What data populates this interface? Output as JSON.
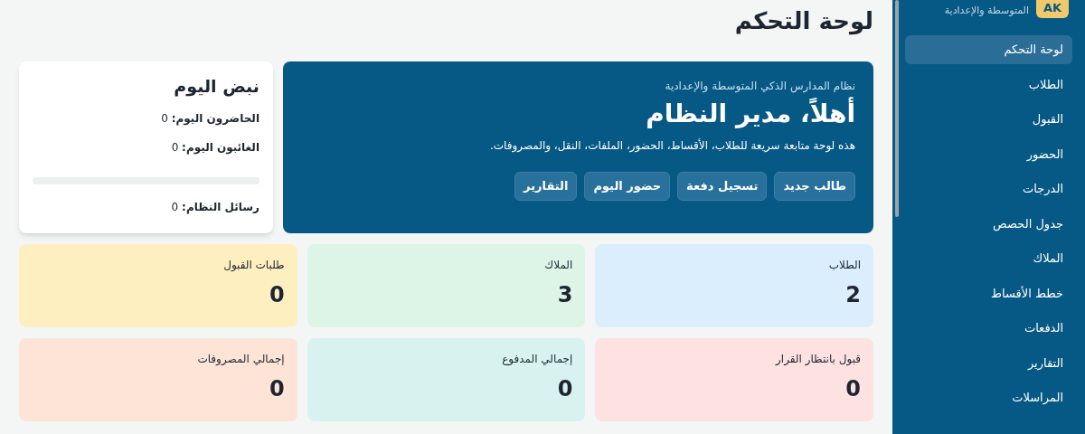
{
  "sidebar": {
    "avatar": "AK",
    "subtitle": "المتوسطة والإعدادية",
    "items": [
      {
        "label": "لوحة التحكم",
        "selected": true
      },
      {
        "label": "الطلاب",
        "selected": false
      },
      {
        "label": "القبول",
        "selected": false
      },
      {
        "label": "الحضور",
        "selected": false
      },
      {
        "label": "الدرجات",
        "selected": false
      },
      {
        "label": "جدول الحصص",
        "selected": false
      },
      {
        "label": "الملاك",
        "selected": false
      },
      {
        "label": "خطط الأقساط",
        "selected": false
      },
      {
        "label": "الدفعات",
        "selected": false
      },
      {
        "label": "التقارير",
        "selected": false
      },
      {
        "label": "المراسلات",
        "selected": false
      }
    ]
  },
  "page_title": "لوحة التحكم",
  "hero": {
    "eyebrow": "نظام المدارس الذكي المتوسطة والإعدادية",
    "title": "أهلاً، مدير النظام",
    "description": "هذه لوحة متابعة سريعة للطلاب، الأقساط، الحضور، الملفات، النقل، والمصروفات.",
    "buttons": [
      "طالب جديد",
      "تسجيل دفعة",
      "حضور اليوم",
      "التقارير"
    ]
  },
  "pulse": {
    "title": "نبض اليوم",
    "rows": [
      {
        "label": "الحاضرون اليوم:",
        "value": "0"
      },
      {
        "label": "الغائبون اليوم:",
        "value": "0"
      }
    ],
    "level": 0,
    "messages": {
      "label": "رسائل النظام:",
      "value": "0"
    }
  },
  "stats": [
    {
      "label": "الطلاب",
      "value": "2",
      "color": "#dbeefe"
    },
    {
      "label": "الملاك",
      "value": "3",
      "color": "#dcf5e7"
    },
    {
      "label": "طلبات القبول",
      "value": "0",
      "color": "#feefc0"
    },
    {
      "label": "قبول بانتظار القرار",
      "value": "0",
      "color": "#fee1e1"
    },
    {
      "label": "إجمالي المدفوع",
      "value": "0",
      "color": "#d8f3ef"
    },
    {
      "label": "إجمالي المصروفات",
      "value": "0",
      "color": "#fee4d6"
    }
  ]
}
